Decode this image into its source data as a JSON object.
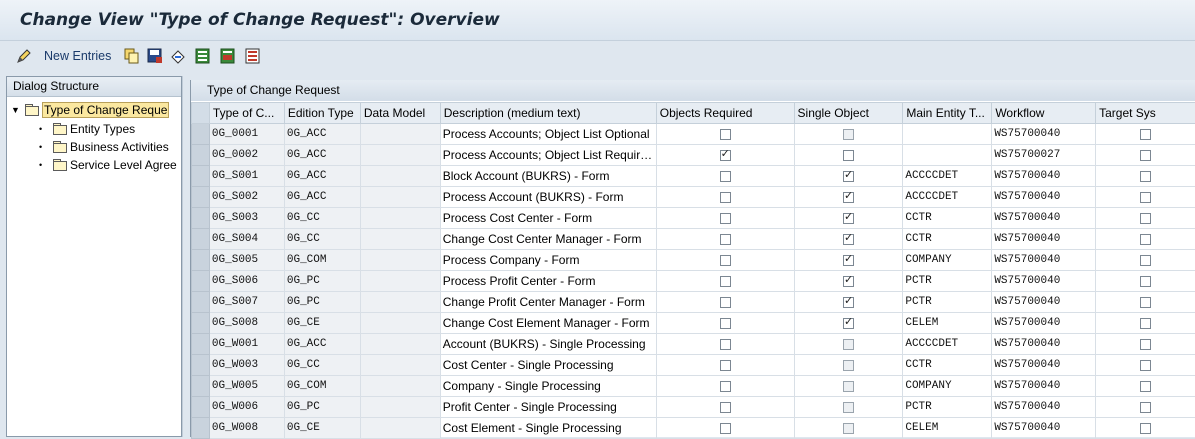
{
  "window": {
    "title": "Change View \"Type of Change Request\": Overview"
  },
  "toolbar": {
    "new_entries_label": "New Entries",
    "icons": [
      "edit-pencil-icon",
      "copy-icon",
      "save-icon",
      "undo-icon",
      "select-all-icon",
      "select-block-icon",
      "deselect-all-icon"
    ]
  },
  "dialog_structure": {
    "header": "Dialog Structure",
    "items": [
      {
        "label": "Type of Change Reque",
        "level": 0,
        "selected": true,
        "expanded": true
      },
      {
        "label": "Entity Types",
        "level": 1
      },
      {
        "label": "Business Activities",
        "level": 1
      },
      {
        "label": "Service Level Agree",
        "level": 1
      }
    ]
  },
  "table": {
    "title": "Type of Change Request",
    "columns": [
      "Type of C...",
      "Edition Type",
      "Data Model",
      "Description (medium text)",
      "Objects Required",
      "Single Object",
      "Main Entity T...",
      "Workflow",
      "Target Sys"
    ],
    "rows": [
      {
        "type": "0G_0001",
        "edition": "0G_ACC",
        "model": "",
        "desc": "Process Accounts; Object List Optional",
        "obj_req": false,
        "single": false,
        "single_disabled": true,
        "entity": "",
        "workflow": "WS75700040",
        "target": false
      },
      {
        "type": "0G_0002",
        "edition": "0G_ACC",
        "model": "",
        "desc": "Process Accounts; Object List Requir…",
        "obj_req": true,
        "single": false,
        "single_disabled": false,
        "entity": "",
        "workflow": "WS75700027",
        "target": false
      },
      {
        "type": "0G_S001",
        "edition": "0G_ACC",
        "model": "",
        "desc": "Block Account (BUKRS) - Form",
        "obj_req": false,
        "single": true,
        "single_disabled": false,
        "entity": "ACCCCDET",
        "workflow": "WS75700040",
        "target": false
      },
      {
        "type": "0G_S002",
        "edition": "0G_ACC",
        "model": "",
        "desc": "Process Account (BUKRS) - Form",
        "obj_req": false,
        "single": true,
        "single_disabled": false,
        "entity": "ACCCCDET",
        "workflow": "WS75700040",
        "target": false
      },
      {
        "type": "0G_S003",
        "edition": "0G_CC",
        "model": "",
        "desc": "Process Cost Center - Form",
        "obj_req": false,
        "single": true,
        "single_disabled": false,
        "entity": "CCTR",
        "workflow": "WS75700040",
        "target": false
      },
      {
        "type": "0G_S004",
        "edition": "0G_CC",
        "model": "",
        "desc": "Change Cost Center Manager - Form",
        "obj_req": false,
        "single": true,
        "single_disabled": false,
        "entity": "CCTR",
        "workflow": "WS75700040",
        "target": false
      },
      {
        "type": "0G_S005",
        "edition": "0G_COM",
        "model": "",
        "desc": "Process Company - Form",
        "obj_req": false,
        "single": true,
        "single_disabled": false,
        "entity": "COMPANY",
        "workflow": "WS75700040",
        "target": false
      },
      {
        "type": "0G_S006",
        "edition": "0G_PC",
        "model": "",
        "desc": "Process Profit Center - Form",
        "obj_req": false,
        "single": true,
        "single_disabled": false,
        "entity": "PCTR",
        "workflow": "WS75700040",
        "target": false
      },
      {
        "type": "0G_S007",
        "edition": "0G_PC",
        "model": "",
        "desc": "Change Profit Center Manager - Form",
        "obj_req": false,
        "single": true,
        "single_disabled": false,
        "entity": "PCTR",
        "workflow": "WS75700040",
        "target": false
      },
      {
        "type": "0G_S008",
        "edition": "0G_CE",
        "model": "",
        "desc": "Change Cost Element Manager - Form",
        "obj_req": false,
        "single": true,
        "single_disabled": false,
        "entity": "CELEM",
        "workflow": "WS75700040",
        "target": false
      },
      {
        "type": "0G_W001",
        "edition": "0G_ACC",
        "model": "",
        "desc": "Account (BUKRS) - Single Processing",
        "obj_req": false,
        "single": false,
        "single_disabled": true,
        "entity": "ACCCCDET",
        "workflow": "WS75700040",
        "target": false
      },
      {
        "type": "0G_W003",
        "edition": "0G_CC",
        "model": "",
        "desc": "Cost Center - Single Processing",
        "obj_req": false,
        "single": false,
        "single_disabled": true,
        "entity": "CCTR",
        "workflow": "WS75700040",
        "target": false
      },
      {
        "type": "0G_W005",
        "edition": "0G_COM",
        "model": "",
        "desc": "Company - Single Processing",
        "obj_req": false,
        "single": false,
        "single_disabled": true,
        "entity": "COMPANY",
        "workflow": "WS75700040",
        "target": false
      },
      {
        "type": "0G_W006",
        "edition": "0G_PC",
        "model": "",
        "desc": "Profit Center - Single Processing",
        "obj_req": false,
        "single": false,
        "single_disabled": true,
        "entity": "PCTR",
        "workflow": "WS75700040",
        "target": false
      },
      {
        "type": "0G_W008",
        "edition": "0G_CE",
        "model": "",
        "desc": "Cost Element - Single Processing",
        "obj_req": false,
        "single": false,
        "single_disabled": true,
        "entity": "CELEM",
        "workflow": "WS75700040",
        "target": false
      }
    ]
  }
}
